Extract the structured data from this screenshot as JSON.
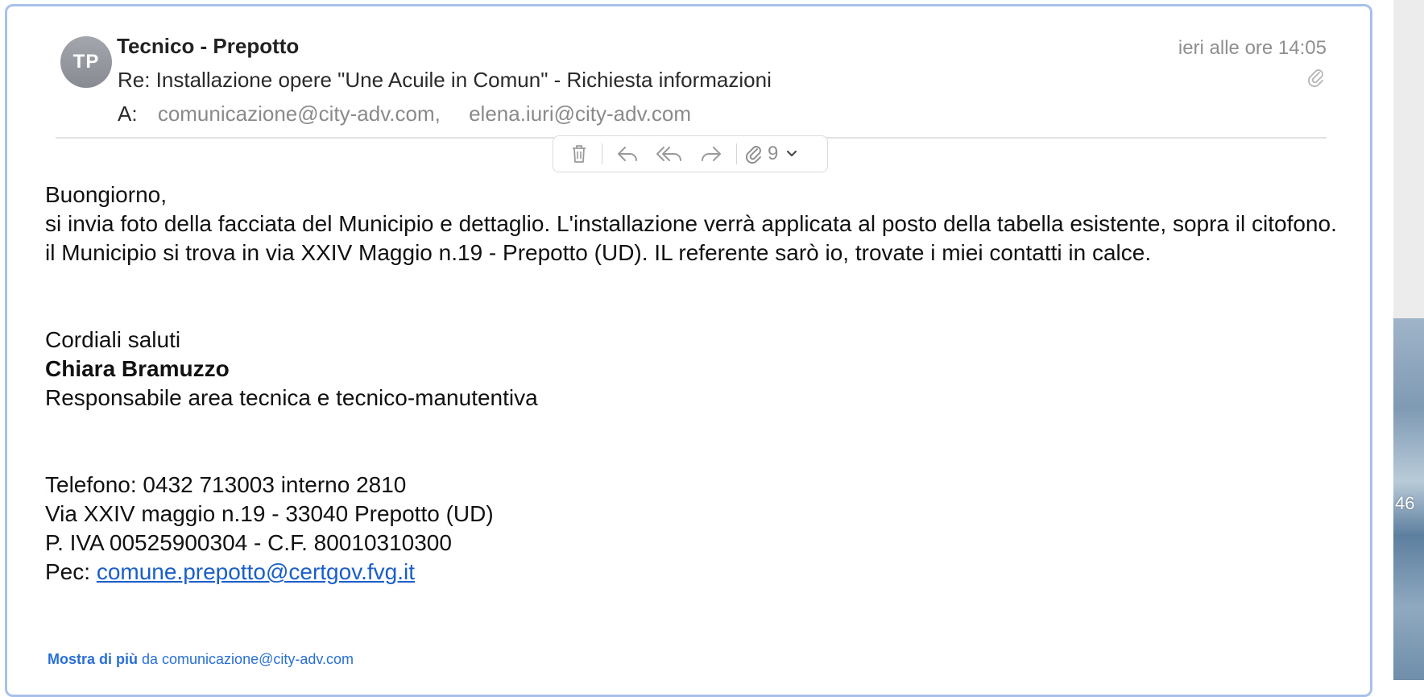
{
  "desktop": {
    "side_time": "46"
  },
  "message": {
    "avatar_initials": "TP",
    "sender": "Tecnico - Prepotto",
    "subject": "Re: Installazione opere \"Une Acuile in Comun\" - Richiesta informazioni",
    "to_label": "A:",
    "recipients": [
      "comunicazione@city-adv.com,",
      "elena.iuri@city-adv.com"
    ],
    "date": "ieri alle ore 14:05",
    "attachment_count": "9"
  },
  "toolbar": {
    "icons": [
      "trash-icon",
      "reply-icon",
      "reply-all-icon",
      "forward-icon",
      "paperclip-icon",
      "chevron-down-icon"
    ]
  },
  "body": {
    "greeting": "Buongiorno,",
    "paragraph": "si invia foto della facciata del Municipio e dettaglio. L'installazione verrà applicata al posto della tabella esistente, sopra il citofono. il Municipio si trova in via XXIV Maggio n.19 - Prepotto (UD). IL referente sarò io, trovate i miei contatti in calce.",
    "closing": "Cordiali saluti",
    "signature_name": "Chiara Bramuzzo",
    "signature_role": "Responsabile area tecnica e tecnico-manutentiva",
    "phone": "Telefono: 0432 713003 interno 2810",
    "address": "Via XXIV maggio n.19 - 33040 Prepotto (UD)",
    "vat": "P. IVA 00525900304 - C.F. 80010310300",
    "pec_label": "Pec: ",
    "pec_link": "comune.prepotto@certgov.fvg.it"
  },
  "footer": {
    "show_more": "Mostra di più",
    "from_text": " da comunicazione@city-adv.com"
  },
  "colors": {
    "window_border": "#a9c1ea",
    "link": "#1a5fc9",
    "muted": "#8f8f8f"
  }
}
